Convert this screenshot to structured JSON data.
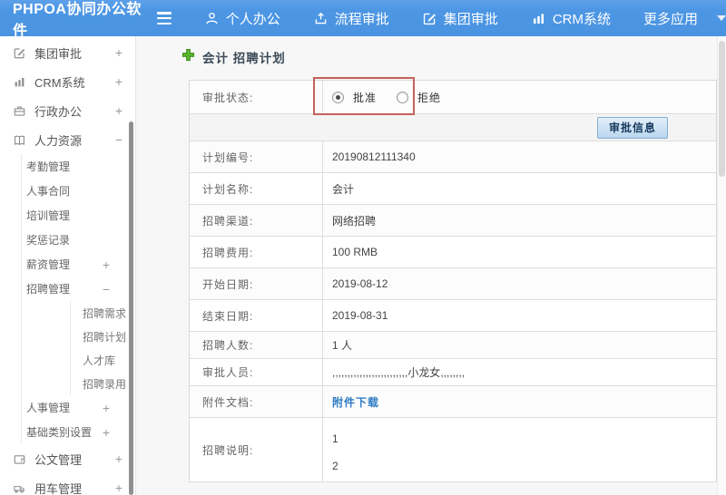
{
  "colors": {
    "topbar_blue": "#4c96e4",
    "annotation_red": "#c4615d",
    "link_blue": "#2f7cc4",
    "plus_green": "#57b62e"
  },
  "topbar": {
    "logo": "PHPOA协同办公软件",
    "nav": [
      {
        "label": "个人办公",
        "icon": "user-icon"
      },
      {
        "label": "流程审批",
        "icon": "workflow-icon"
      },
      {
        "label": "集团审批",
        "icon": "edit-icon"
      },
      {
        "label": "CRM系统",
        "icon": "bar-chart-icon"
      },
      {
        "label": "更多应用",
        "icon": "caret-down-icon"
      }
    ]
  },
  "sidebar": {
    "items": [
      {
        "label": "集团审批",
        "toggle": "+"
      },
      {
        "label": "CRM系统",
        "toggle": "+"
      },
      {
        "label": "行政办公",
        "toggle": "+"
      },
      {
        "label": "人力资源",
        "toggle": "−"
      },
      {
        "label": "考勤管理",
        "toggle": ""
      },
      {
        "label": "人事合同",
        "toggle": ""
      },
      {
        "label": "培训管理",
        "toggle": ""
      },
      {
        "label": "奖惩记录",
        "toggle": ""
      },
      {
        "label": "薪资管理",
        "toggle": "+"
      },
      {
        "label": "招聘管理",
        "toggle": "−"
      },
      {
        "label": "招聘需求",
        "toggle": ""
      },
      {
        "label": "招聘计划",
        "toggle": ""
      },
      {
        "label": "人才库",
        "toggle": ""
      },
      {
        "label": "招聘录用",
        "toggle": ""
      },
      {
        "label": "人事管理",
        "toggle": "+"
      },
      {
        "label": "基础类别设置",
        "toggle": "+"
      },
      {
        "label": "公文管理",
        "toggle": "+"
      },
      {
        "label": "用车管理",
        "toggle": "+"
      }
    ]
  },
  "main": {
    "title": "会计 招聘计划",
    "approval": {
      "label": "审批状态:",
      "options": [
        {
          "label": "批准",
          "selected": true
        },
        {
          "label": "拒绝",
          "selected": false
        }
      ]
    },
    "approval_info_button": "审批信息",
    "fields": [
      {
        "label": "计划编号:",
        "value": "20190812111340"
      },
      {
        "label": "计划名称:",
        "value": "会计"
      },
      {
        "label": "招聘渠道:",
        "value": "网络招聘"
      },
      {
        "label": "招聘费用:",
        "value": "100 RMB"
      },
      {
        "label": "开始日期:",
        "value": "2019-08-12"
      },
      {
        "label": "结束日期:",
        "value": "2019-08-31"
      },
      {
        "label": "招聘人数:",
        "value": "1 人"
      },
      {
        "label": "审批人员:",
        "value": ",,,,,,,,,,,,,,,,,,,,,,,,,小龙女,,,,,,,,"
      },
      {
        "label": "附件文档:",
        "value": "附件下载"
      },
      {
        "label": "招聘说明:",
        "lines": [
          "1",
          "2"
        ]
      }
    ]
  }
}
